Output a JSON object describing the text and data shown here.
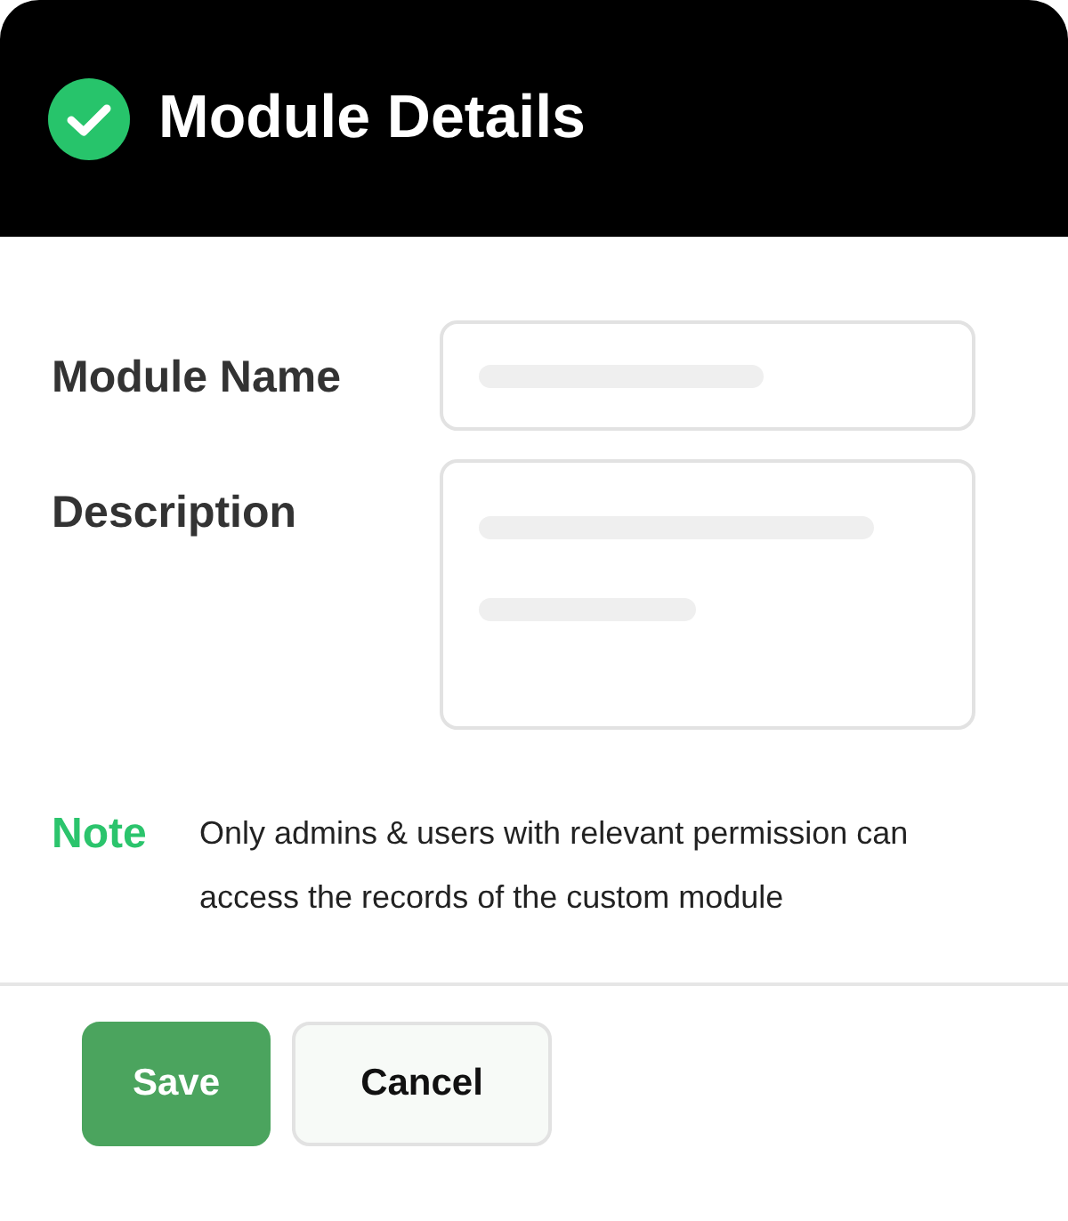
{
  "dialog": {
    "title": "Module Details"
  },
  "fields": [
    {
      "label": "Module Name",
      "kind": "single"
    },
    {
      "label": "Description",
      "kind": "multi"
    }
  ],
  "note": {
    "label": "Note",
    "text": "Only admins & users with relevant permission can access the records of the custom module"
  },
  "buttons": [
    {
      "label": "Save",
      "kind": "primary"
    },
    {
      "label": "Cancel",
      "kind": "secondary"
    }
  ]
}
